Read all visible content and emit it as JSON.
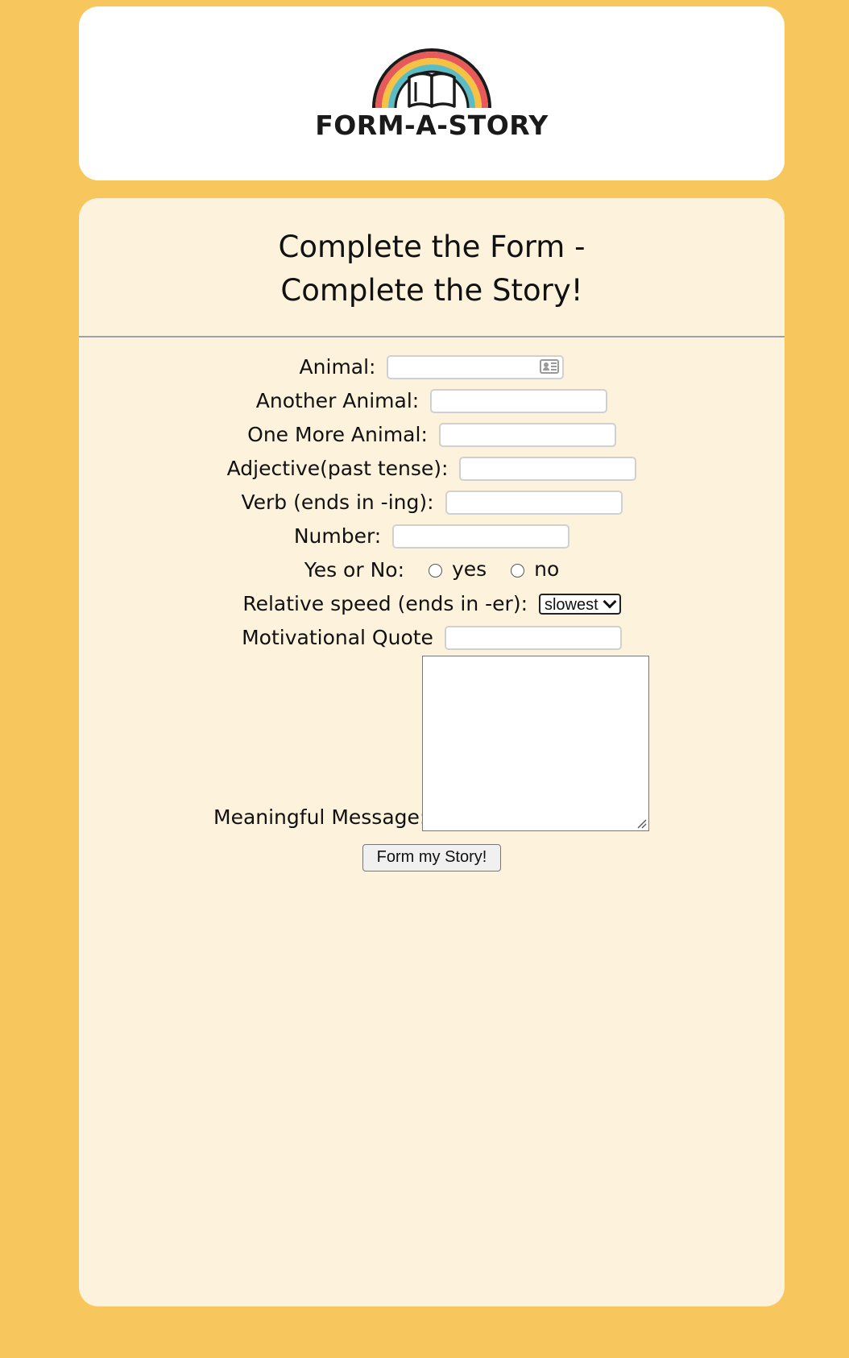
{
  "header": {
    "logo_text": "FORM-A-STORY",
    "logo_colors": [
      "#e8595a",
      "#f6c244",
      "#5bbcc4"
    ]
  },
  "main": {
    "title_line1": "Complete the Form -",
    "title_line2": "Complete the Story!"
  },
  "form": {
    "animal_label": "Animal:",
    "animal_value": "",
    "another_animal_label": "Another Animal:",
    "another_animal_value": "",
    "one_more_animal_label": "One More Animal:",
    "one_more_animal_value": "",
    "adjective_label": "Adjective(past tense):",
    "adjective_value": "",
    "verb_label": "Verb (ends in -ing):",
    "verb_value": "",
    "number_label": "Number:",
    "number_value": "",
    "yes_no_label": "Yes or No:",
    "yes_option": "yes",
    "no_option": "no",
    "speed_label": "Relative speed (ends in -er):",
    "speed_selected": "slowest",
    "quote_label": "Motivational Quote",
    "quote_value": "",
    "message_label": "Meaningful Message:",
    "message_value": "",
    "submit_label": "Form my Story!"
  },
  "icons": {
    "contact_autofill": "contact-card-icon",
    "select_arrow": "chevron-down-icon",
    "logo": "rainbow-book-icon"
  }
}
